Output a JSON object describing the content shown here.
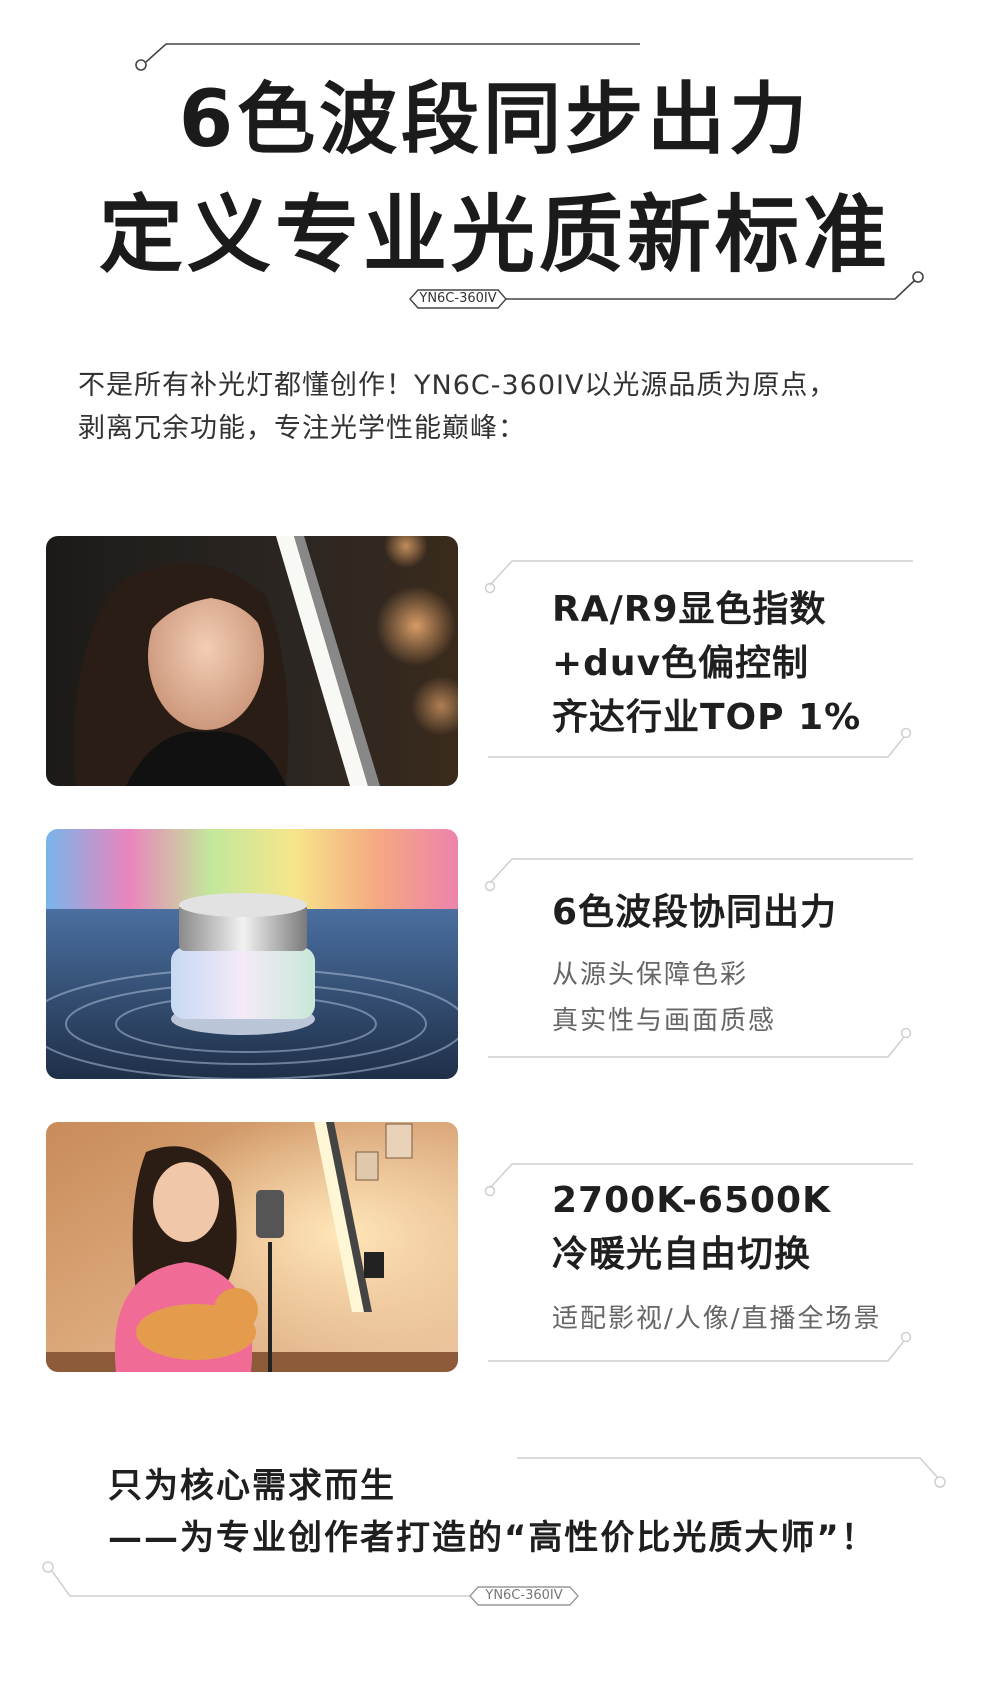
{
  "header": {
    "title_line1": "6色波段同步出力",
    "title_line2": "定义专业光质新标准",
    "model_tag": "YN6C-360IV"
  },
  "intro": {
    "line1": "不是所有补光灯都懂创作！YN6C-360IV以光源品质为原点，",
    "line2": "剥离冗余功能，专注光学性能巅峰："
  },
  "features": [
    {
      "lines": [
        "RA/R9显色指数",
        "+duv色偏控制",
        "齐达行业TOP 1%"
      ]
    },
    {
      "title": "6色波段协同出力",
      "sub": [
        "从源头保障色彩",
        "真实性与画面质感"
      ]
    },
    {
      "lines": [
        "2700K-6500K",
        "冷暖光自由切换"
      ],
      "sub": "适配影视/人像/直播全场景"
    }
  ],
  "closing": {
    "line1": "只为核心需求而生",
    "line2": "——为专业创作者打造的“高性价比光质大师”！",
    "model_tag": "YN6C-360IV"
  }
}
